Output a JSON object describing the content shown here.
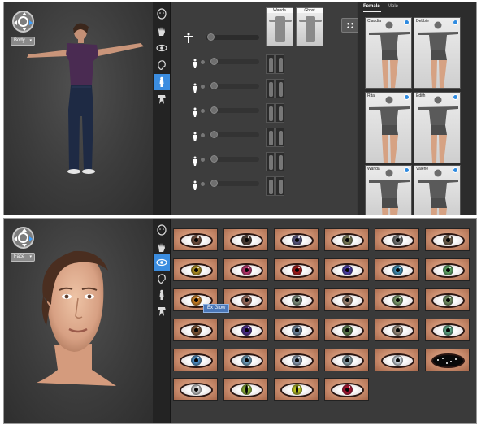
{
  "top_panel": {
    "mode_label": "Body",
    "pose_thumbnails": [
      {
        "label": "Wanda"
      },
      {
        "label": "Ghost"
      }
    ],
    "tabs": [
      "Female",
      "Male"
    ],
    "active_tab": "Female",
    "body_presets": [
      {
        "label": "Claudia"
      },
      {
        "label": "Debbie"
      },
      {
        "label": "Rita"
      },
      {
        "label": "Edith"
      },
      {
        "label": "Wanda"
      },
      {
        "label": "Valerie"
      }
    ]
  },
  "bottom_panel": {
    "mode_label": "Face",
    "tooltip": "Ex Glow",
    "eye_rows": [
      [
        {
          "iris": "#6b4a3a"
        },
        {
          "iris": "#4a3a32"
        },
        {
          "iris": "#55527a"
        },
        {
          "iris": "#7a7a55"
        },
        {
          "iris": "#707070"
        },
        {
          "iris": "#6a5a48"
        }
      ],
      [
        {
          "iris": "#a98a1e"
        },
        {
          "iris": "#b8306a"
        },
        {
          "iris": "#a01818"
        },
        {
          "iris": "#4b3ba8"
        },
        {
          "iris": "#3c8ab0"
        },
        {
          "iris": "#5aa060"
        }
      ],
      [
        {
          "iris": "#c57a20"
        },
        {
          "iris": "#9a6a5a"
        },
        {
          "iris": "#7a8a78"
        },
        {
          "iris": "#a08470"
        },
        {
          "iris": "#7a9a6a"
        },
        {
          "iris": "#6d8a5e"
        }
      ],
      [
        {
          "iris": "#7a5030"
        },
        {
          "iris": "#4a2a8a"
        },
        {
          "iris": "#6a8098"
        },
        {
          "iris": "#5a7a4a"
        },
        {
          "iris": "#9a8a7a"
        },
        {
          "iris": "#5aa080"
        }
      ],
      [
        {
          "iris": "#4a8ac0"
        },
        {
          "iris": "#6a9ab8"
        },
        {
          "iris": "#8a9ab0"
        },
        {
          "iris": "#8aa0a8"
        },
        {
          "iris": "#c8d0d8"
        },
        {
          "iris": "black"
        }
      ],
      [
        {
          "iris": "#c8c8c8"
        },
        {
          "iris": "#8ab030"
        },
        {
          "iris": "#b8c020"
        },
        {
          "iris": "#b01030"
        }
      ]
    ]
  },
  "colors": {
    "accent": "#3b8de0",
    "panel_bg": "#3a3a3a",
    "toolbar_bg": "#232323"
  }
}
